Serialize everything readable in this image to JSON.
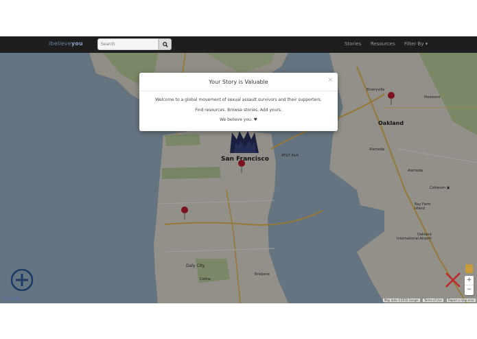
{
  "brand": {
    "prefix": "ibelieve",
    "suffix": "you"
  },
  "search": {
    "placeholder": "Search"
  },
  "nav": {
    "stories": "Stories",
    "resources": "Resources",
    "filter": "Filter By ▾"
  },
  "map_labels": {
    "san_francisco": "San Francisco",
    "oakland": "Oakland",
    "alameda": "Alameda",
    "alameda2": "Alameda",
    "daly_city": "Daly City",
    "emeryville": "Emeryville",
    "piedmont": "Piedmont",
    "coliseum": "Coliseum ▣",
    "bay_farm": "Bay Farm\nIsland",
    "airport": "Oakland\nInternational Airport",
    "colma": "Colma",
    "brisbane": "Brisbane",
    "att_park": "AT&T Park"
  },
  "modal": {
    "title": "Your Story is Valuable",
    "close": "×",
    "line1": "Welcome to a global movement of sexual assault survivors and their supporters.",
    "line2": "Find resources. Browse stories. Add yours.",
    "line3": "We believe you. ♥"
  },
  "map_controls": {
    "zoom_in": "+",
    "zoom_out": "−"
  },
  "google_logo": "Google",
  "attribution": {
    "data": "Map data ©2016 Google",
    "terms": "Terms of Use",
    "report": "Report a map error"
  },
  "colors": {
    "navbar": "#1e1e1e",
    "pin": "#c81e2e",
    "x_button": "#c0282b",
    "add_button": "#1f3a66"
  }
}
